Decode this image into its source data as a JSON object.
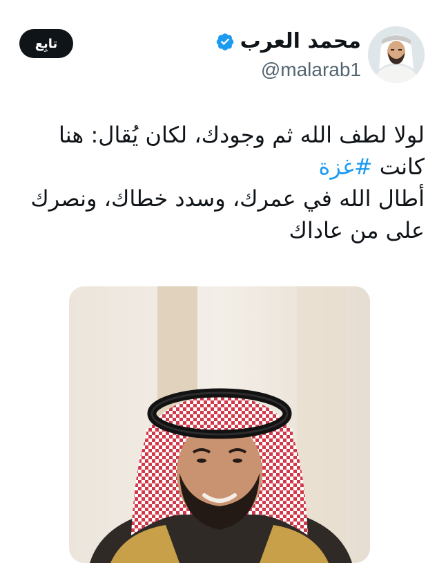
{
  "author": {
    "display_name": "محمد العرب",
    "handle": "@malarab1",
    "verified": true,
    "avatar_icon": "profile-photo"
  },
  "actions": {
    "follow_label": "تابِع"
  },
  "tweet": {
    "line1": "لولا لطف الله ثم وجودك، لكان يُقال: هنا",
    "line2_prefix": "كانت ",
    "hashtag": "#غزة",
    "line3": "أطال الله في عمرك، وسدد خطاك، ونصرك",
    "line4": "على من عاداك"
  },
  "media": {
    "icon": "attached-photo"
  },
  "colors": {
    "text": "#0f1419",
    "secondary_text": "#536471",
    "link": "#1d9bf0",
    "verified_badge": "#1d9bf0",
    "button_bg": "#0f1419",
    "button_text": "#ffffff"
  }
}
